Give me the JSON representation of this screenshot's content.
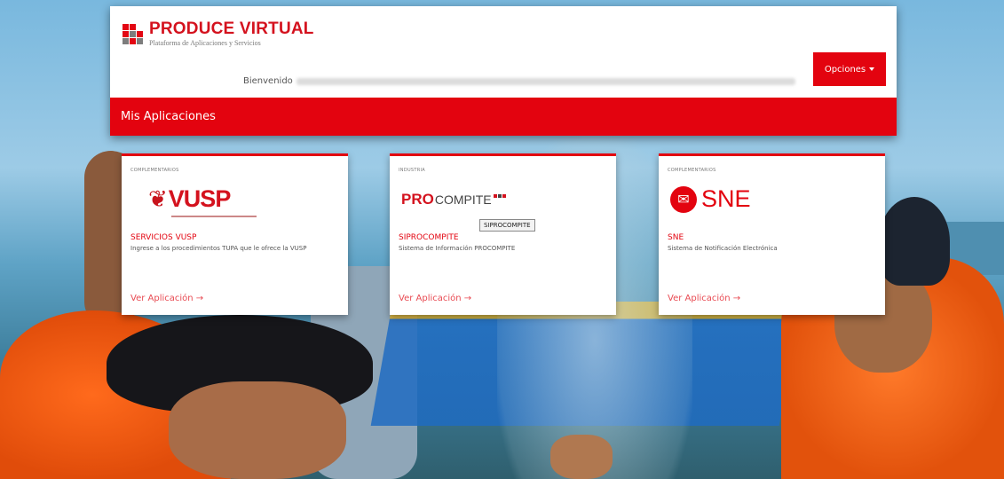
{
  "brand": {
    "title": "PRODUCE VIRTUAL",
    "subtitle": "Plataforma de Aplicaciones y Servicios"
  },
  "header": {
    "welcome_label": "Bienvenido",
    "options_button": "Opciones"
  },
  "section": {
    "title": "Mis Aplicaciones"
  },
  "cards": [
    {
      "category": "COMPLEMENTARIOS",
      "logo_text": "VUSP",
      "title": "SERVICIOS VUSP",
      "description": "Ingrese a los procedimientos TUPA que le ofrece la VUSP",
      "link": "Ver Aplicación →"
    },
    {
      "category": "INDUSTRIA",
      "logo_text_bold": "PRO",
      "logo_text_rest": "COMPITE",
      "title": "SIPROCOMPITE",
      "description": "Sistema de Información PROCOMPITE",
      "link": "Ver Aplicación →",
      "tooltip": "SIPROCOMPITE"
    },
    {
      "category": "COMPLEMENTARIOS",
      "logo_text": "SNE",
      "title": "SNE",
      "description": "Sistema de Notificación Electrónica",
      "link": "Ver Aplicación →"
    }
  ],
  "icons": {
    "brand": "produce-logo-icon",
    "options_caret": "caret-down-icon",
    "vusp": "bird-icon",
    "sne": "notification-icon"
  },
  "colors": {
    "accent": "#e3030f",
    "brand_red": "#d4121e"
  }
}
